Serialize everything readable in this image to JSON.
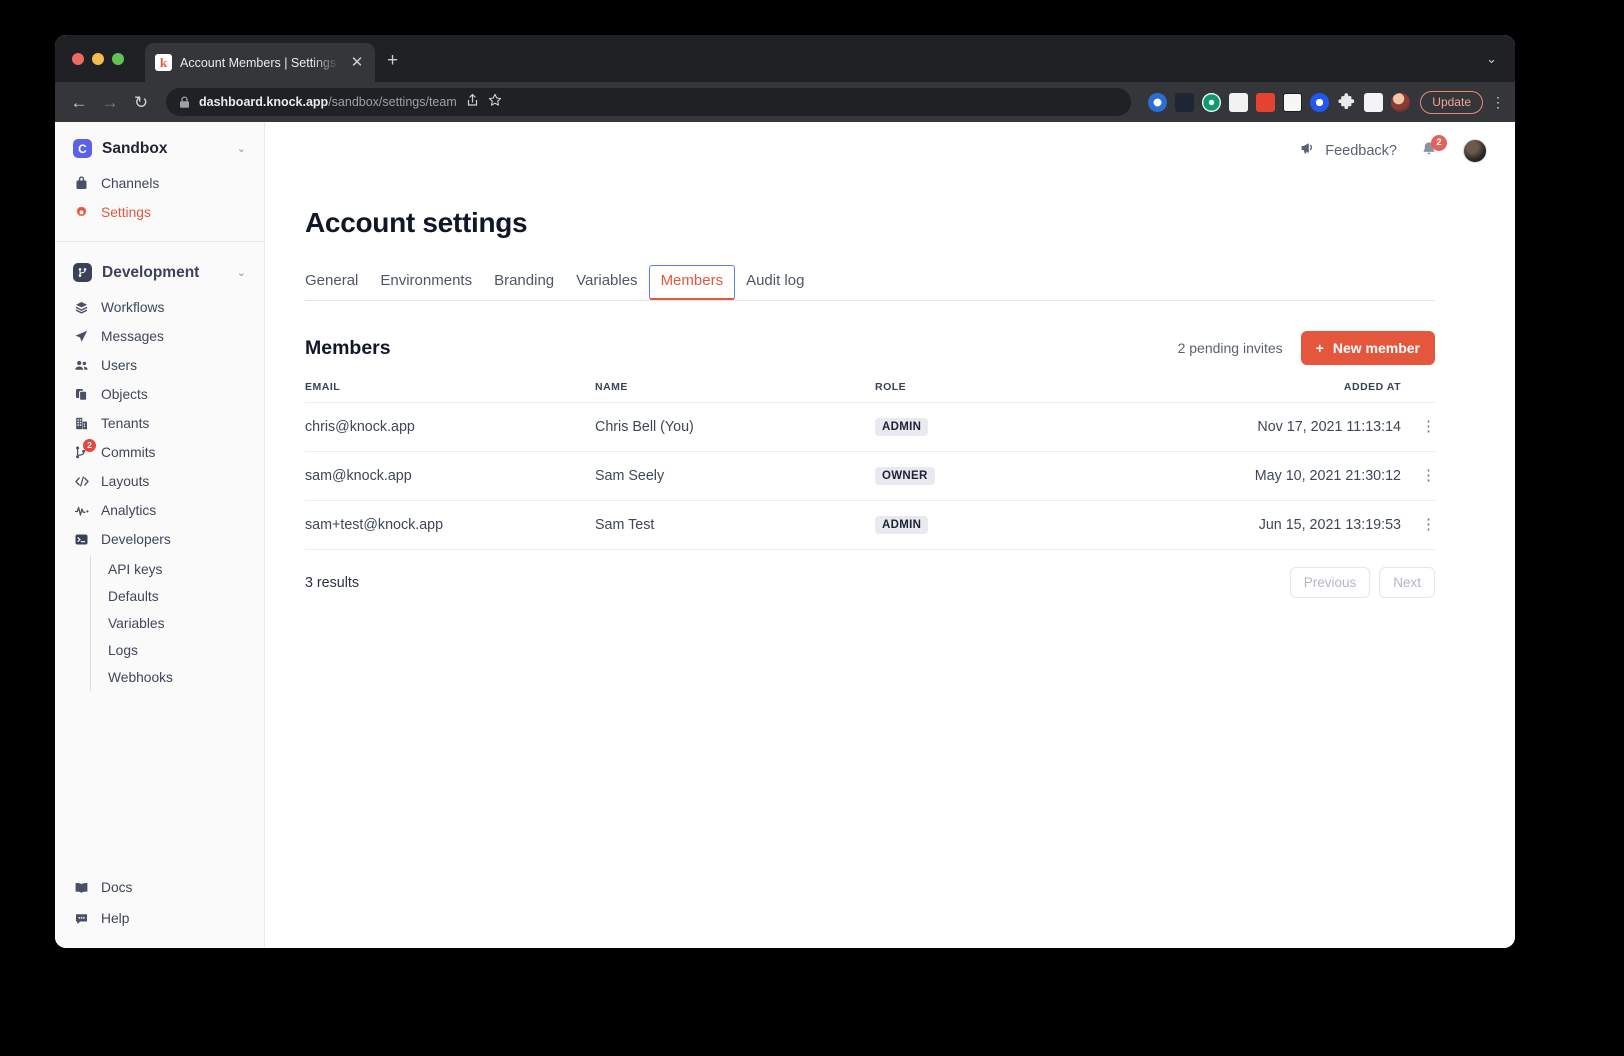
{
  "browser": {
    "tab": {
      "title": "Account Members | Settings | K",
      "favicon": "knock-favicon",
      "close": "✕"
    },
    "new_tab": "+",
    "tabstrip_chevron": "⌄",
    "nav": {
      "back": "←",
      "forward": "→",
      "reload": "↻"
    },
    "url": {
      "domain": "dashboard.knock.app",
      "path": "/sandbox/settings/team"
    },
    "update_button": "Update",
    "menu": "⋮",
    "extensions": [
      {
        "name": "extension-icon-1",
        "color": "#2b6fd6"
      },
      {
        "name": "react-devtools-icon",
        "color": "#1d2733"
      },
      {
        "name": "extension-icon-3",
        "color": "#0e9b6e"
      },
      {
        "name": "picture-in-picture-icon",
        "color": "#f2f2f2"
      },
      {
        "name": "todoist-icon",
        "color": "#e44332"
      },
      {
        "name": "notion-icon",
        "color": "#f7f7f5"
      },
      {
        "name": "extension-icon-7",
        "color": "#2158f0"
      },
      {
        "name": "puzzle-icon",
        "color": "#e8eaed"
      },
      {
        "name": "sidepanel-icon",
        "color": "#f4f4f6"
      },
      {
        "name": "profile-avatar-icon",
        "color": "#6b4a3a"
      }
    ]
  },
  "sidebar": {
    "account": {
      "badge": "C",
      "badge_color": "#5a63e8",
      "name": "Sandbox",
      "chevron": "⌄",
      "items": [
        {
          "label": "Channels",
          "icon": "channels-icon",
          "active": false
        },
        {
          "label": "Settings",
          "icon": "gear-icon",
          "active": true
        }
      ]
    },
    "environment": {
      "badge_icon": "branch-icon",
      "name": "Development",
      "chevron": "⌄",
      "items": [
        {
          "label": "Workflows",
          "icon": "layers-icon",
          "badge": ""
        },
        {
          "label": "Messages",
          "icon": "send-icon",
          "badge": ""
        },
        {
          "label": "Users",
          "icon": "users-icon",
          "badge": ""
        },
        {
          "label": "Objects",
          "icon": "objects-icon",
          "badge": ""
        },
        {
          "label": "Tenants",
          "icon": "building-icon",
          "badge": ""
        },
        {
          "label": "Commits",
          "icon": "commit-icon",
          "badge": "2"
        },
        {
          "label": "Layouts",
          "icon": "code-icon",
          "badge": ""
        },
        {
          "label": "Analytics",
          "icon": "analytics-icon",
          "badge": ""
        },
        {
          "label": "Developers",
          "icon": "terminal-icon",
          "badge": ""
        }
      ],
      "sub_items": [
        {
          "label": "API keys"
        },
        {
          "label": "Defaults"
        },
        {
          "label": "Variables"
        },
        {
          "label": "Logs"
        },
        {
          "label": "Webhooks"
        }
      ]
    },
    "footer": [
      {
        "label": "Docs",
        "icon": "book-icon"
      },
      {
        "label": "Help",
        "icon": "chat-bubble-icon"
      }
    ]
  },
  "topbar": {
    "feedback_label": "Feedback?",
    "feedback_icon": "megaphone-icon",
    "bell_icon": "bell-icon",
    "notification_count": "2",
    "avatar": "user-avatar"
  },
  "main": {
    "page_title": "Account settings",
    "tabs": [
      {
        "label": "General",
        "selected": false
      },
      {
        "label": "Environments",
        "selected": false
      },
      {
        "label": "Branding",
        "selected": false
      },
      {
        "label": "Variables",
        "selected": false
      },
      {
        "label": "Members",
        "selected": true
      },
      {
        "label": "Audit log",
        "selected": false
      }
    ],
    "section_title": "Members",
    "pending_invites": "2 pending invites",
    "new_member_label": "New member",
    "new_member_plus": "+",
    "accent_color": "#e4573d",
    "table": {
      "columns": [
        "EMAIL",
        "NAME",
        "ROLE",
        "ADDED AT"
      ],
      "rows": [
        {
          "email": "chris@knock.app",
          "name": "Chris Bell (You)",
          "role": "ADMIN",
          "added_at": "Nov 17, 2021 11:13:14",
          "menu": "⋮"
        },
        {
          "email": "sam@knock.app",
          "name": "Sam Seely",
          "role": "OWNER",
          "added_at": "May 10, 2021 21:30:12",
          "menu": "⋮"
        },
        {
          "email": "sam+test@knock.app",
          "name": "Sam Test",
          "role": "ADMIN",
          "added_at": "Jun 15, 2021 13:19:53",
          "menu": "⋮"
        }
      ]
    },
    "results_count": "3 results",
    "pager": {
      "previous": "Previous",
      "next": "Next"
    }
  }
}
